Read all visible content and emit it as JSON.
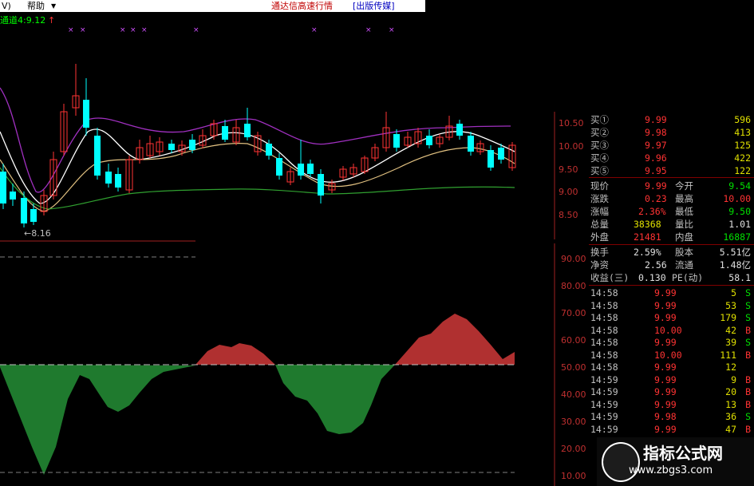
{
  "menubar": {
    "menu_view": "V)",
    "menu_help": "帮助",
    "caret": "▼",
    "title": "通达信高速行情",
    "publisher": "[出版传媒]"
  },
  "main_chart": {
    "indicator_label": "通道4:9.12",
    "indicator_arrow": "↑",
    "low_mark": "←8.16",
    "price_axis": [
      "10.50",
      "10.00",
      "9.50",
      "9.00",
      "8.50"
    ]
  },
  "sub_chart": {
    "axis": [
      "90.00",
      "80.00",
      "70.00",
      "60.00",
      "50.00",
      "40.00",
      "30.00",
      "20.00",
      "10.00"
    ]
  },
  "order_book": [
    {
      "label": "买①",
      "price": "9.99",
      "vol": "596"
    },
    {
      "label": "买②",
      "price": "9.98",
      "vol": "413"
    },
    {
      "label": "买③",
      "price": "9.97",
      "vol": "125"
    },
    {
      "label": "买④",
      "price": "9.96",
      "vol": "422"
    },
    {
      "label": "买⑤",
      "price": "9.95",
      "vol": "122"
    }
  ],
  "quote": {
    "now_label": "现价",
    "now": "9.99",
    "open_label": "今开",
    "open": "9.54",
    "chg_label": "涨跌",
    "chg": "0.23",
    "high_label": "最高",
    "high": "10.00",
    "pct_label": "涨幅",
    "pct": "2.36%",
    "low_label": "最低",
    "low": "9.50",
    "vol_label": "总量",
    "vol": "38368",
    "ratio_label": "量比",
    "ratio": "1.01",
    "outer_label": "外盘",
    "outer": "21481",
    "inner_label": "内盘",
    "inner": "16887"
  },
  "fundamentals": {
    "turnover_label": "换手",
    "turnover": "2.59%",
    "shares_label": "股本",
    "shares": "5.51亿",
    "netasset_label": "净资",
    "netasset": "2.56",
    "float_label": "流通",
    "float": "1.48亿",
    "eps_label": "收益(三)",
    "eps": "0.130",
    "pe_label": "PE(动)",
    "pe": "58.1"
  },
  "ticks": [
    {
      "time": "14:58",
      "price": "9.99",
      "vol": "5",
      "side": "S"
    },
    {
      "time": "14:58",
      "price": "9.99",
      "vol": "53",
      "side": "S"
    },
    {
      "time": "14:58",
      "price": "9.99",
      "vol": "179",
      "side": "S"
    },
    {
      "time": "14:58",
      "price": "10.00",
      "vol": "42",
      "side": "B"
    },
    {
      "time": "14:58",
      "price": "9.99",
      "vol": "39",
      "side": "S"
    },
    {
      "time": "14:58",
      "price": "10.00",
      "vol": "111",
      "side": "B"
    },
    {
      "time": "14:58",
      "price": "9.99",
      "vol": "12",
      "side": ""
    },
    {
      "time": "14:59",
      "price": "9.99",
      "vol": "9",
      "side": "B"
    },
    {
      "time": "14:59",
      "price": "9.99",
      "vol": "20",
      "side": "B"
    },
    {
      "time": "14:59",
      "price": "9.99",
      "vol": "13",
      "side": "B"
    },
    {
      "time": "14:59",
      "price": "9.98",
      "vol": "36",
      "side": "S"
    },
    {
      "time": "14:59",
      "price": "9.99",
      "vol": "47",
      "side": "B"
    }
  ],
  "watermark": {
    "title": "指标公式网",
    "url": "www.zbgs3.com"
  },
  "colors": {
    "up": "#ff3333",
    "down": "#00ffff",
    "purple": "#a030c0",
    "white": "#ffffff",
    "tan": "#e0c080",
    "green": "#30a030",
    "area_up": "#b03030",
    "area_down": "#1f7a2e"
  }
}
